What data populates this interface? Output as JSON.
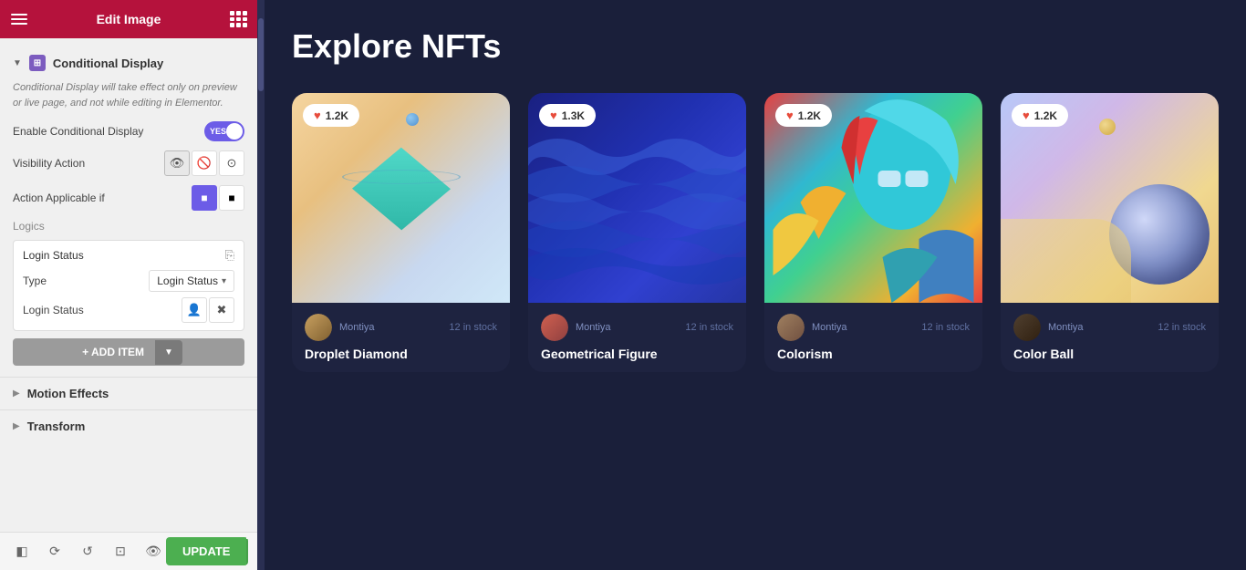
{
  "header": {
    "title": "Edit Image",
    "hamburger_label": "menu",
    "grid_label": "grid"
  },
  "panel": {
    "conditional_display": {
      "section_title": "Conditional Display",
      "icon_label": "conditional-icon",
      "info_text": "Conditional Display will take effect only on preview or live page, and not while editing in Elementor.",
      "enable_label": "Enable Conditional Display",
      "toggle_yes": "YES",
      "toggle_on": true,
      "visibility_label": "Visibility Action",
      "action_applicable_label": "Action Applicable if",
      "logics_label": "Logics",
      "login_status_title": "Login Status",
      "type_label": "Type",
      "type_value": "Login Status",
      "login_status_label": "Login Status",
      "add_item_label": "+ ADD ITEM"
    },
    "motion_effects": {
      "section_title": "Motion Effects"
    },
    "transform": {
      "section_title": "Transform"
    }
  },
  "bottom_toolbar": {
    "update_label": "UPDATE"
  },
  "main": {
    "title": "Explore NFTs",
    "cards": [
      {
        "title": "Droplet Diamond",
        "author": "Montiya",
        "stock": "12 in stock",
        "likes": "1.2K",
        "bg_class": "card-bg-1"
      },
      {
        "title": "Geometrical Figure",
        "author": "Montiya",
        "stock": "12 in stock",
        "likes": "1.3K",
        "bg_class": "card-bg-2"
      },
      {
        "title": "Colorism",
        "author": "Montiya",
        "stock": "12 in stock",
        "likes": "1.2K",
        "bg_class": "card-bg-3"
      },
      {
        "title": "Color Ball",
        "author": "Montiya",
        "stock": "12 in stock",
        "likes": "1.2K",
        "bg_class": "card-bg-4"
      }
    ]
  }
}
